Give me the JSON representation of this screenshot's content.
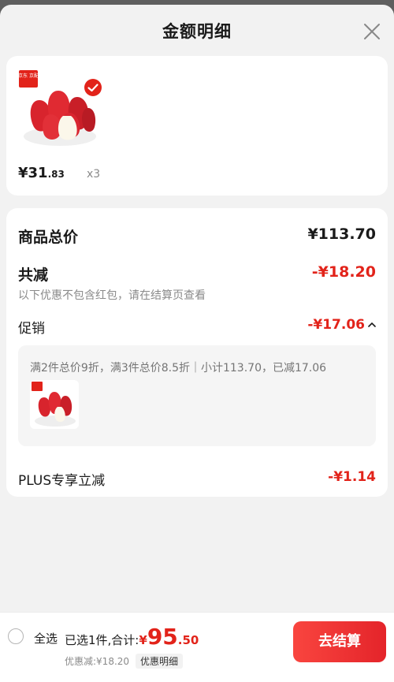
{
  "header": {
    "title": "金额明细"
  },
  "product": {
    "badge_text": "京东 京配",
    "price_main": "¥31",
    "price_decimal": ".83",
    "quantity": "x3"
  },
  "summary": {
    "total_label": "商品总价",
    "total_value": "¥113.70",
    "reduce_label": "共减",
    "reduce_value": "-¥18.20",
    "reduce_note": "以下优惠不包含红包，请在结算页查看",
    "promo_label": "促销",
    "promo_value": "-¥17.06",
    "promo_desc": "满2件总价9折，满3件总价8.5折｜小计113.70，已减17.06",
    "plus_label": "PLUS专享立减",
    "plus_value": "-¥1.14"
  },
  "footer": {
    "select_all": "全选",
    "selected_text": "已选1件,合计:",
    "currency": "¥",
    "total_int": "95",
    "total_dec": ".50",
    "discount_text": "优惠减:¥18.20",
    "detail_tag": "优惠明细",
    "checkout_label": "去结算"
  },
  "colors": {
    "accent": "#e2231a",
    "background": "#f2f2f2"
  },
  "icons": [
    "close-icon",
    "check-icon",
    "chevron-up-icon"
  ]
}
